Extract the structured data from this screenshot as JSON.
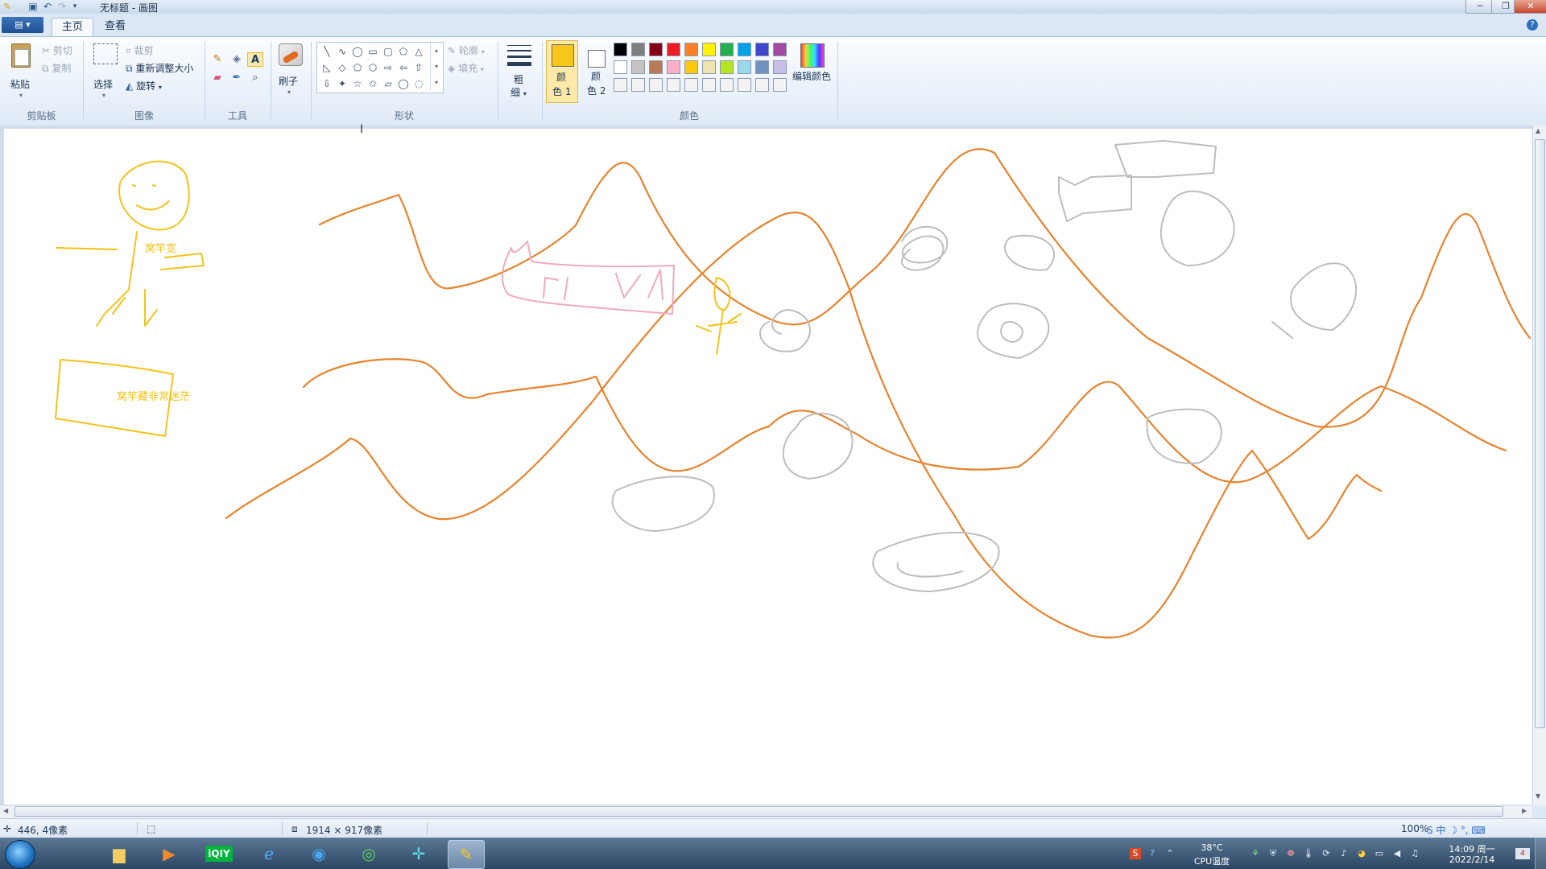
{
  "window": {
    "title": "无标题 - 画图",
    "controls": {
      "minimize": "─",
      "restore": "❐",
      "close": "✕"
    }
  },
  "quick_access": {
    "app_icon": "paint-app-icon",
    "save": "save-icon",
    "undo": "undo-icon",
    "redo": "redo-icon",
    "customize": "dropdown-icon"
  },
  "tabs": {
    "menu": "▤ ▾",
    "home": "主页",
    "view": "查看"
  },
  "ribbon": {
    "clipboard": {
      "paste": "粘贴",
      "cut": "剪切",
      "copy": "复制",
      "label": "剪贴板"
    },
    "image": {
      "select": "选择",
      "crop": "裁剪",
      "resize": "重新调整大小",
      "rotate": "旋转",
      "label": "图像"
    },
    "tools": {
      "label": "工具",
      "items": [
        "pencil-icon",
        "fill-icon",
        "text-icon",
        "eraser-icon",
        "color-picker-icon",
        "magnifier-icon"
      ],
      "text_glyph": "A"
    },
    "brushes": {
      "label": "刷子"
    },
    "shapes": {
      "label": "形状",
      "outline": "轮廓",
      "fill": "填充",
      "glyphs": [
        "╲",
        "∿",
        "◯",
        "▭",
        "▢",
        "⬠",
        "△",
        "◺",
        "◇",
        "⬠",
        "⬡",
        "⇨",
        "⇦",
        "⇧",
        "⇩",
        "✦",
        "☆",
        "✩",
        "▱",
        "◯",
        "◌"
      ]
    },
    "size": {
      "label_line1": "粗",
      "label_line2": "细"
    },
    "colors": {
      "label": "颜色",
      "color1": {
        "line1": "颜",
        "line2": "色 1",
        "value": "#f6c71a"
      },
      "color2": {
        "line1": "颜",
        "line2": "色 2",
        "value": "#ffffff"
      },
      "edit": "编辑颜色",
      "palette_row1": [
        "#000000",
        "#7f7f7f",
        "#880015",
        "#ed1c24",
        "#ff7f27",
        "#fff200",
        "#22b14c",
        "#00a2e8",
        "#3f48cc",
        "#a349a4"
      ],
      "palette_row2": [
        "#ffffff",
        "#c3c3c3",
        "#b97a57",
        "#ffaec9",
        "#ffc90e",
        "#efe4b0",
        "#b5e61d",
        "#99d9ea",
        "#7092be",
        "#c8bfe7"
      ],
      "palette_row3": [
        "#f3f3f3",
        "#f3f3f3",
        "#f3f3f3",
        "#f3f3f3",
        "#f3f3f3",
        "#f3f3f3",
        "#f3f3f3",
        "#f3f3f3",
        "#f3f3f3",
        "#f3f3f3"
      ]
    }
  },
  "canvas": {
    "text1": "窝竿宽",
    "text2": "窝竿藏非常迷茫"
  },
  "statusbar": {
    "cursor_pos": "446, 4像素",
    "canvas_size": "1914 × 917像素",
    "zoom": "100%"
  },
  "taskbar": {
    "apps": [
      "folder-icon",
      "media-player-icon",
      "iqiyi-icon",
      "ie-icon",
      "edge-icon",
      "browser-icon",
      "app-icon",
      "paint-icon"
    ],
    "iqiyi": "iQIY",
    "temp": "38°C",
    "temp_label": "CPU温度",
    "time": "14:09 周一",
    "date": "2022/2/14",
    "ime": "S 中 ☽ °, ⌨"
  }
}
